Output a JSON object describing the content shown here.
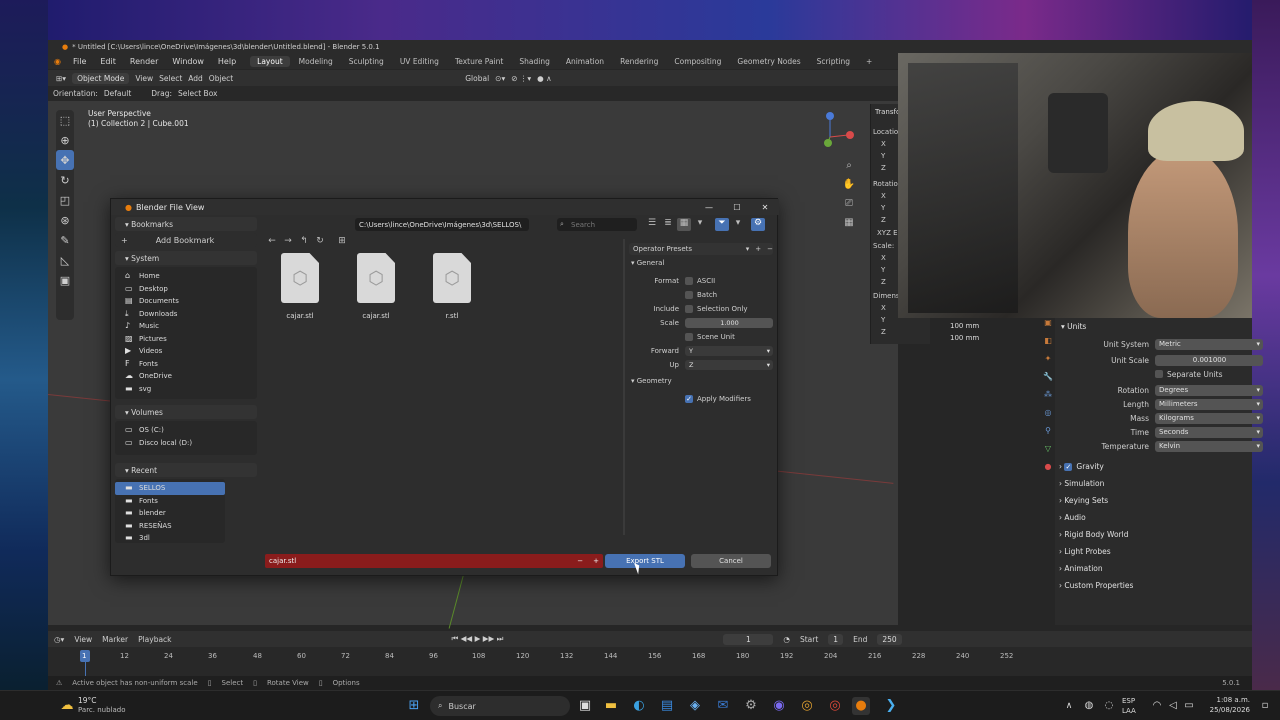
{
  "window_title": "* Untitled [C:\\Users\\lince\\OneDrive\\Imágenes\\3d\\blender\\Untitled.blend] - Blender 5.0.1",
  "menu": [
    "File",
    "Edit",
    "Render",
    "Window",
    "Help"
  ],
  "workspaces": [
    "Layout",
    "Modeling",
    "Sculpting",
    "UV Editing",
    "Texture Paint",
    "Shading",
    "Animation",
    "Rendering",
    "Compositing",
    "Geometry Nodes",
    "Scripting",
    "+"
  ],
  "header": {
    "mode": "Object Mode",
    "view": "View",
    "select": "Select",
    "add": "Add",
    "object": "Object",
    "transform": "Global"
  },
  "header2": {
    "orientation_label": "Orientation:",
    "orientation": "Default",
    "drag_label": "Drag:",
    "drag": "Select Box"
  },
  "viewport": {
    "perspective": "User Perspective",
    "collection": "(1) Collection 2 | Cube.001"
  },
  "npanel": {
    "tab": "Transform",
    "location": "Location",
    "rotation": "Rotation",
    "scale": "Scale:",
    "dimensions": "Dimensions",
    "rot_mode": "XYZ E",
    "axes": [
      "X",
      "Y",
      "Z"
    ],
    "dim_y": "100 mm",
    "dim_z": "100 mm"
  },
  "dialog": {
    "title": "Blender File View",
    "path": "C:\\Users\\lince\\OneDrive\\Imágenes\\3d\\SELLOS\\",
    "search_placeholder": "Search",
    "bookmarks_title": "Bookmarks",
    "add_bookmark": "Add Bookmark",
    "system_title": "System",
    "system_items": [
      "Home",
      "Desktop",
      "Documents",
      "Downloads",
      "Music",
      "Pictures",
      "Videos",
      "Fonts",
      "OneDrive",
      "svg"
    ],
    "volumes_title": "Volumes",
    "volume_items": [
      "OS (C:)",
      "Disco local (D:)"
    ],
    "recent_title": "Recent",
    "recent_items": [
      "SELLOS",
      "Fonts",
      "blender",
      "RESEÑAS",
      "3dl"
    ],
    "files": [
      "cajar.stl",
      "cajar.stl",
      "r.stl"
    ],
    "operator_presets": "Operator Presets",
    "general": "General",
    "format_label": "Format",
    "format_ascii": "ASCII",
    "format_batch": "Batch",
    "include_label": "Include",
    "selection_only": "Selection Only",
    "scale_label": "Scale",
    "scale_value": "1.000",
    "scene_unit": "Scene Unit",
    "forward_label": "Forward",
    "forward_value": "Y",
    "up_label": "Up",
    "up_value": "Z",
    "geometry": "Geometry",
    "apply_modifiers": "Apply Modifiers",
    "filename": "cajar.stl",
    "export_button": "Export STL",
    "cancel_button": "Cancel"
  },
  "properties": {
    "units_title": "Units",
    "unit_system_label": "Unit System",
    "unit_system": "Metric",
    "unit_scale_label": "Unit Scale",
    "unit_scale": "0.001000",
    "separate_units": "Separate Units",
    "rotation_label": "Rotation",
    "rotation": "Degrees",
    "length_label": "Length",
    "length": "Millimeters",
    "mass_label": "Mass",
    "mass": "Kilograms",
    "time_label": "Time",
    "time": "Seconds",
    "temperature_label": "Temperature",
    "temperature": "Kelvin",
    "panels": [
      "Gravity",
      "Simulation",
      "Keying Sets",
      "Audio",
      "Rigid Body World",
      "Light Probes",
      "Animation",
      "Custom Properties"
    ]
  },
  "timeline": {
    "view": "View",
    "marker": "Marker",
    "playback": "Playback",
    "current": "1",
    "start_label": "Start",
    "start": "1",
    "end_label": "End",
    "end": "250",
    "ticks": [
      "1",
      "12",
      "24",
      "36",
      "48",
      "60",
      "72",
      "84",
      "96",
      "108",
      "120",
      "132",
      "144",
      "156",
      "168",
      "180",
      "192",
      "204",
      "216",
      "228",
      "240",
      "252"
    ]
  },
  "statusbar": {
    "warning": "Active object has non-uniform scale",
    "select": "Select",
    "rotate": "Rotate View",
    "options": "Options",
    "version": "5.0.1"
  },
  "taskbar": {
    "weather_temp": "19°C",
    "weather_desc": "Parc. nublado",
    "search": "Buscar",
    "lang": "ESP",
    "region": "LAA",
    "time": "1:08 a.m.",
    "date": "25/08/2026"
  },
  "colors": {
    "accent": "#4772b3",
    "filename_bg": "#8a1c1c",
    "viewport_bg": "#3a3a3a"
  }
}
